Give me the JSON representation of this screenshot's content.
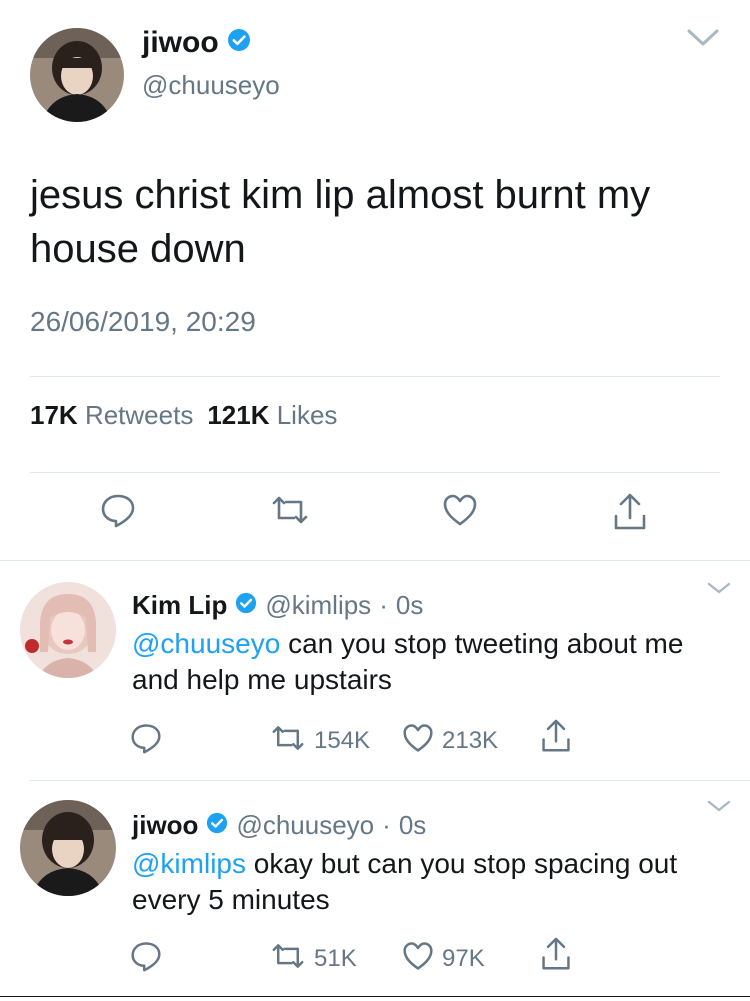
{
  "main_tweet": {
    "name": "jiwoo",
    "handle": "@chuuseyo",
    "text": "jesus christ kim lip almost burnt my house down",
    "date": "26/06/2019, 20:29",
    "retweets_count": "17K",
    "retweets_label": "Retweets",
    "likes_count": "121K",
    "likes_label": "Likes"
  },
  "replies": [
    {
      "name": "Kim Lip",
      "handle": "@kimlips",
      "separator": "·",
      "time": "0s",
      "mention": "@chuuseyo",
      "text": " can you stop tweeting about me and help me upstairs",
      "retweets": "154K",
      "likes": "213K"
    },
    {
      "name": "jiwoo",
      "handle": "@chuuseyo",
      "separator": "·",
      "time": "0s",
      "mention": "@kimlips",
      "text": " okay but can you stop spacing out every 5 minutes",
      "retweets": "51K",
      "likes": "97K"
    }
  ],
  "colors": {
    "accent": "#1da1f2",
    "secondary_text": "#657786",
    "primary_text": "#14171a",
    "divider": "#e1e8ed"
  },
  "icons": [
    "verified-icon",
    "chevron-down-icon",
    "reply-icon",
    "retweet-icon",
    "like-icon",
    "share-icon"
  ]
}
